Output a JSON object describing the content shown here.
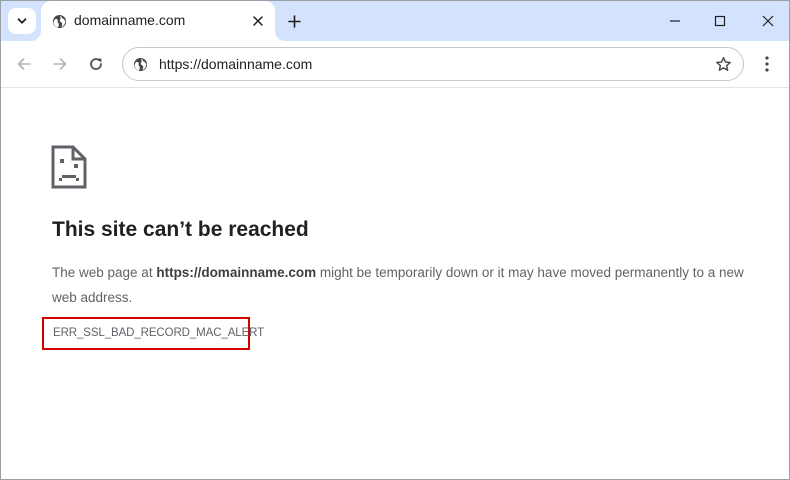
{
  "browser": {
    "tab": {
      "title": "domainname.com"
    },
    "address_bar": {
      "url": "https://domainname.com"
    }
  },
  "page": {
    "heading": "This site can’t be reached",
    "description": {
      "prefix": "The web page at ",
      "url": "https://domainname.com",
      "suffix": " might be temporarily down or it may have moved permanently to a new web address."
    },
    "error_code": "ERR_SSL_BAD_RECORD_MAC_ALERT"
  },
  "icons": {
    "tab_search": "chevron-down-icon",
    "favicon": "globe-icon",
    "tab_close": "close-icon",
    "new_tab": "plus-icon",
    "minimize": "minimize-icon",
    "maximize": "maximize-icon",
    "window_close": "close-icon",
    "back": "arrow-left-icon",
    "forward": "arrow-right-icon",
    "reload": "reload-icon",
    "site_info": "globe-icon",
    "bookmark": "star-icon",
    "menu": "kebab-menu-icon",
    "error": "sad-document-icon"
  },
  "colors": {
    "tab_strip": "#d3e3fd",
    "highlight_border": "#d40000",
    "heading_text": "#202124",
    "body_text": "#5f6368"
  }
}
